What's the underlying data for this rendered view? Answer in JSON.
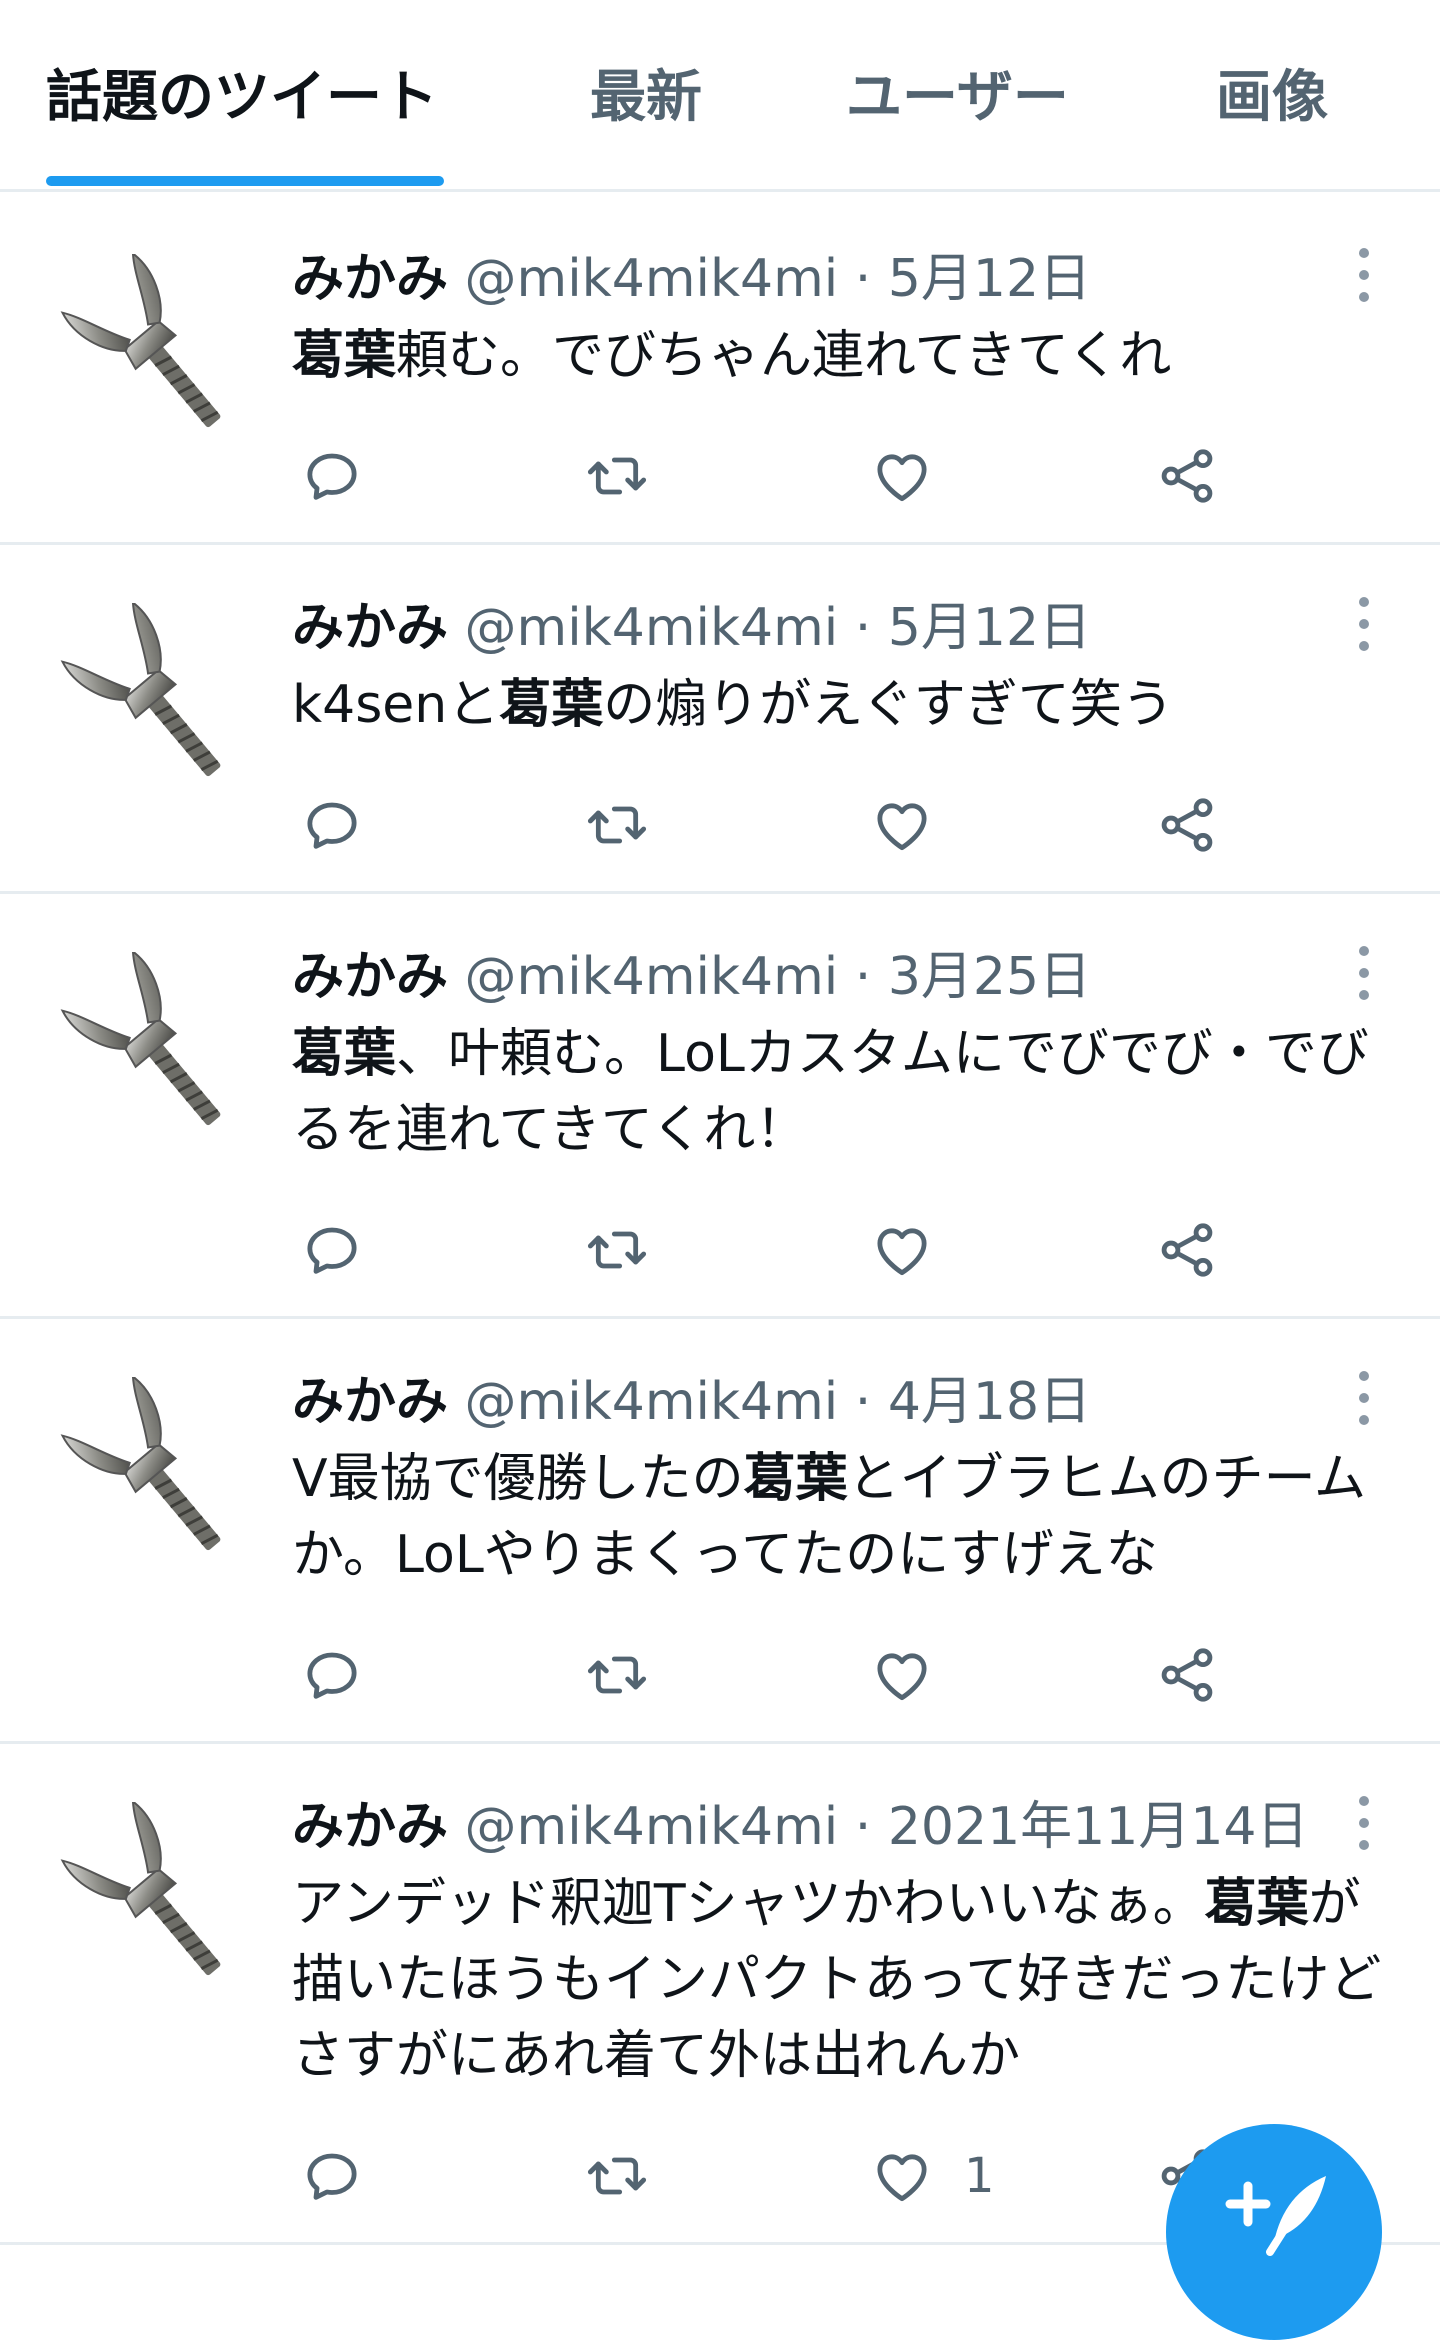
{
  "tabs": [
    {
      "label": "話題のツイート",
      "active": true
    },
    {
      "label": "最新"
    },
    {
      "label": "ユーザー"
    },
    {
      "label": "画像"
    }
  ],
  "tweets": [
    {
      "name": "みかみ",
      "handle": "@mik4mik4mi",
      "sep": "·",
      "date": "5月12日",
      "body": [
        [
          "b",
          "葛葉"
        ],
        [
          "t",
          "頼む。でびちゃん連れてきてくれ"
        ]
      ],
      "like_count": ""
    },
    {
      "name": "みかみ",
      "handle": "@mik4mik4mi",
      "sep": "·",
      "date": "5月12日",
      "body": [
        [
          "t",
          "k4senと"
        ],
        [
          "b",
          "葛葉"
        ],
        [
          "t",
          "の煽りがえぐすぎて笑う"
        ]
      ],
      "like_count": ""
    },
    {
      "name": "みかみ",
      "handle": "@mik4mik4mi",
      "sep": "·",
      "date": "3月25日",
      "body": [
        [
          "b",
          "葛葉"
        ],
        [
          "t",
          "、叶頼む。LoLカスタムにでびでび・でびるを連れてきてくれ！"
        ]
      ],
      "like_count": ""
    },
    {
      "name": "みかみ",
      "handle": "@mik4mik4mi",
      "sep": "·",
      "date": "4月18日",
      "body": [
        [
          "t",
          "V最協で優勝したの"
        ],
        [
          "b",
          "葛葉"
        ],
        [
          "t",
          "とイブラヒムのチームか。LoLやりまくってたのにすげえな"
        ]
      ],
      "like_count": ""
    },
    {
      "name": "みかみ",
      "handle": "@mik4mik4mi",
      "sep": "·",
      "date": "2021年11月14日",
      "body": [
        [
          "t",
          "アンデッド釈迦Tシャツかわいいなぁ。"
        ],
        [
          "b",
          "葛葉"
        ],
        [
          "t",
          "が描いたほうもインパクトあって好きだったけどさすがにあれ着て外は出れんか"
        ]
      ],
      "like_count": "1"
    }
  ],
  "icons": {
    "reply": "reply-icon",
    "retweet": "retweet-icon",
    "like": "heart-icon",
    "share": "share-icon",
    "more": "more-icon",
    "compose": "compose-icon",
    "avatar": "wing-bolt-avatar"
  },
  "colors": {
    "accent": "#1d9bf0",
    "secondary_text": "#536471",
    "divider": "#e6ecf0"
  }
}
